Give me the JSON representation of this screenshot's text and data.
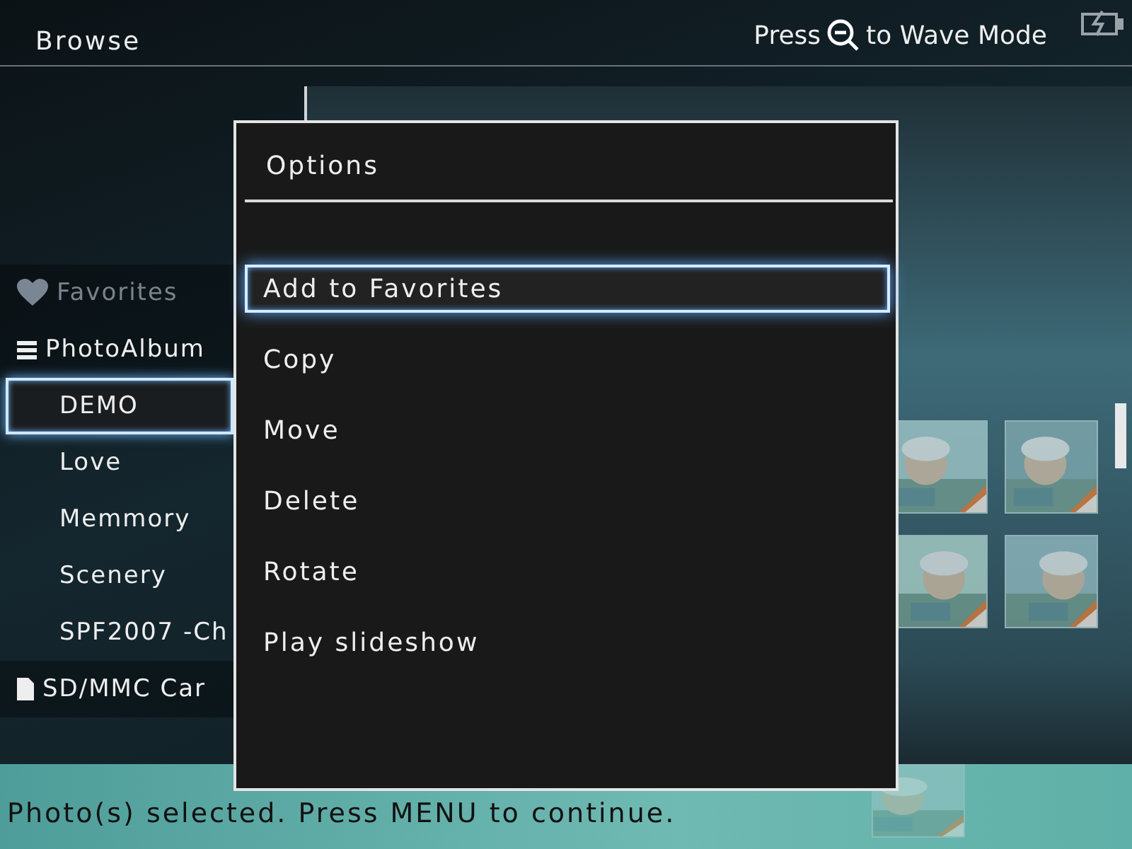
{
  "header": {
    "title": "Browse",
    "hint_before": "Press",
    "hint_after": "to Wave Mode"
  },
  "sidebar": {
    "items": [
      {
        "kind": "favorites",
        "label": "Favorites",
        "disabled": true,
        "selected": false
      },
      {
        "kind": "album",
        "label": "PhotoAlbum",
        "disabled": false,
        "selected": false
      },
      {
        "kind": "folder",
        "label": "DEMO",
        "disabled": false,
        "selected": true
      },
      {
        "kind": "folder",
        "label": "Love",
        "disabled": false,
        "selected": false
      },
      {
        "kind": "folder",
        "label": "Memmory",
        "disabled": false,
        "selected": false
      },
      {
        "kind": "folder",
        "label": "Scenery",
        "disabled": false,
        "selected": false
      },
      {
        "kind": "folder",
        "label": "SPF2007 -Ch",
        "disabled": false,
        "selected": false
      },
      {
        "kind": "card",
        "label": "SD/MMC Car",
        "disabled": false,
        "selected": false
      }
    ]
  },
  "options": {
    "title": "Options",
    "items": [
      {
        "label": "Add to Favorites",
        "selected": true
      },
      {
        "label": "Copy",
        "selected": false
      },
      {
        "label": "Move",
        "selected": false
      },
      {
        "label": "Delete",
        "selected": false
      },
      {
        "label": "Rotate",
        "selected": false
      },
      {
        "label": "Play slideshow",
        "selected": false
      }
    ]
  },
  "status_bar": {
    "text": "Photo(s) selected. Press MENU to continue."
  }
}
